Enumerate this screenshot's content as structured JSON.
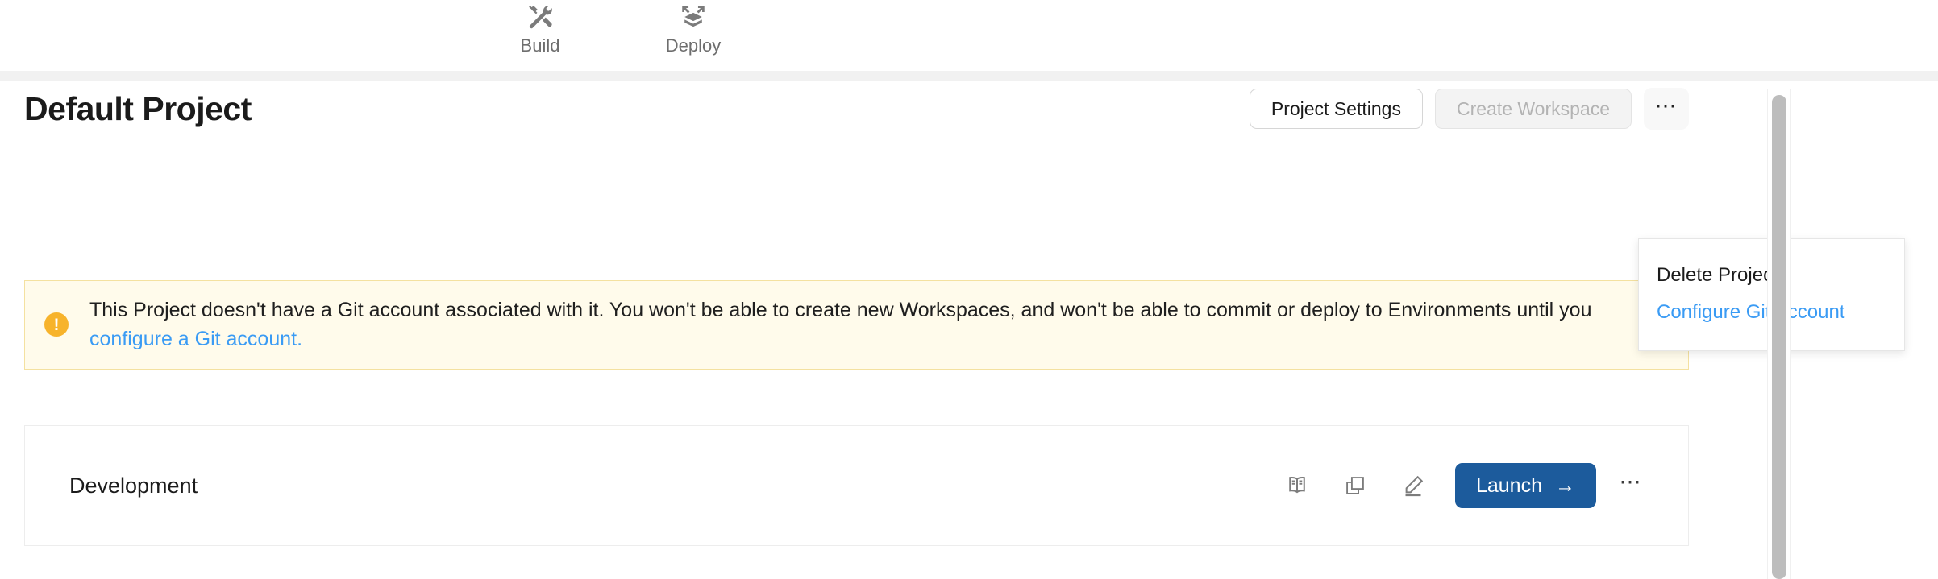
{
  "topnav": {
    "items": [
      {
        "label": "Build",
        "icon": "tools-icon"
      },
      {
        "label": "Deploy",
        "icon": "deploy-box-icon"
      }
    ]
  },
  "header": {
    "title": "Default Project",
    "buttons": {
      "project_settings": "Project Settings",
      "create_workspace": "Create Workspace",
      "more": "⋯"
    }
  },
  "dropdown": {
    "items": [
      {
        "label": "Delete Project",
        "style": "default"
      },
      {
        "label": "Configure Git Account",
        "style": "link"
      }
    ]
  },
  "banner": {
    "icon": "warning-exclamation-icon",
    "text_before": "This Project doesn't have a Git account associated with it. You won't be able to create new Workspaces, and won't be able to commit or deploy to Environments until you ",
    "link_text": "configure a Git account.",
    "colors": {
      "background": "#fffbeb",
      "border": "#f4e1a0",
      "icon": "#f7b32b",
      "link": "#3a9bf4"
    }
  },
  "environment_card": {
    "name": "Development",
    "icons": [
      {
        "name": "docs-book-icon"
      },
      {
        "name": "copy-icon"
      },
      {
        "name": "edit-pencil-icon"
      }
    ],
    "launch_label": "Launch",
    "launch_arrow": "→",
    "more": "⋯",
    "colors": {
      "launch_background": "#1c5b9c"
    }
  },
  "scrollbar": {
    "orientation": "vertical"
  }
}
